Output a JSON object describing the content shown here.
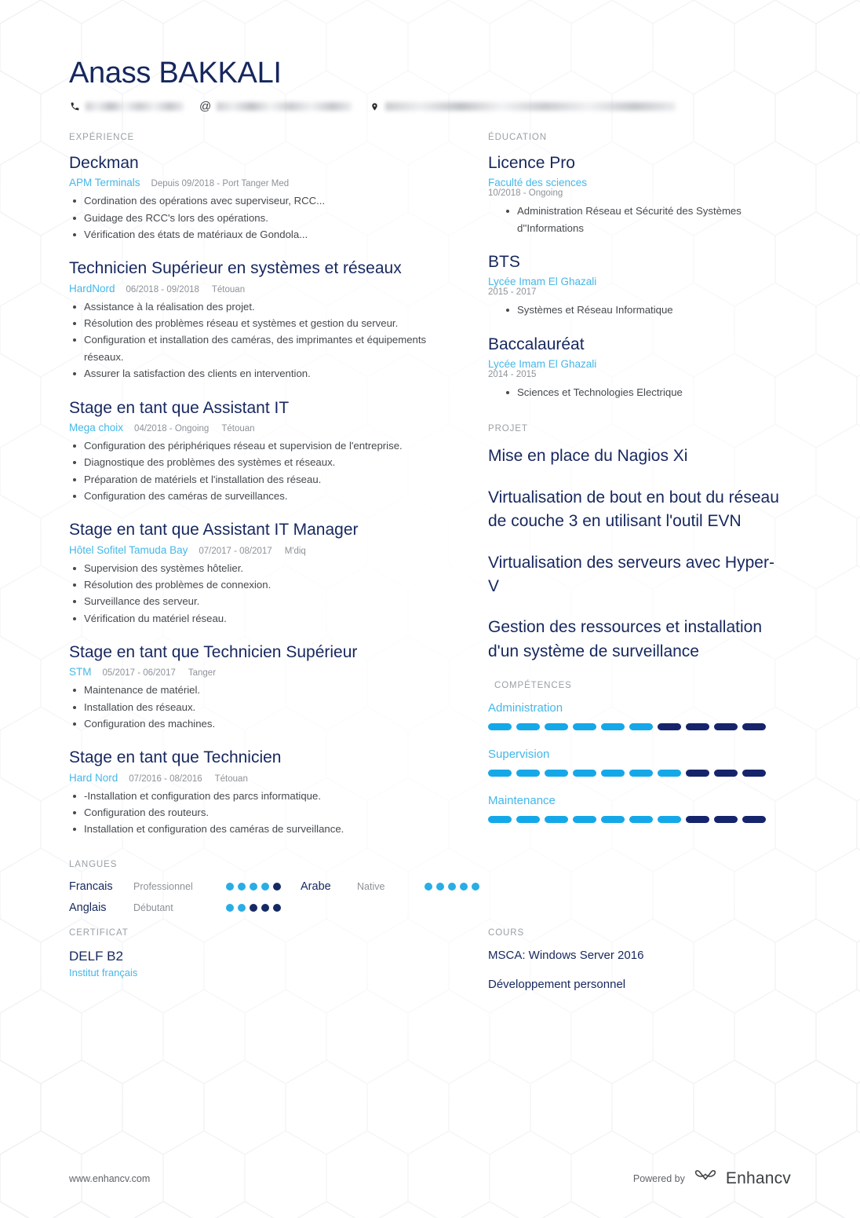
{
  "header": {
    "name": "Anass BAKKALI",
    "contact": {
      "phone_icon": "phone-icon",
      "phone_value": "",
      "email_icon": "at-icon",
      "email_value": "",
      "location_icon": "map-pin-icon",
      "location_value": ""
    }
  },
  "sections": {
    "experience_label": "EXPÉRIENCE",
    "education_label": "ÉDUCATION",
    "project_label": "PROJET",
    "competences_label": "COMPÉTENCES",
    "langues_label": "LANGUES",
    "certificat_label": "CERTIFICAT",
    "cours_label": "COURS"
  },
  "experience": [
    {
      "title": "Deckman",
      "org": "APM Terminals",
      "date": "Depuis 09/2018 - Port Tanger Med",
      "place": "",
      "bullets": [
        "Cordination des opérations avec superviseur, RCC...",
        "Guidage des RCC's lors des opérations.",
        "Vérification des états de matériaux de Gondola..."
      ]
    },
    {
      "title": "Technicien Supérieur en systèmes et réseaux",
      "org": "HardNord",
      "date": "06/2018 - 09/2018",
      "place": "Tétouan",
      "bullets": [
        "Assistance à la réalisation des projet.",
        "Résolution des problèmes réseau et systèmes et gestion du serveur.",
        "Configuration et installation des caméras, des imprimantes et équipements réseaux.",
        "Assurer la satisfaction des clients en intervention."
      ]
    },
    {
      "title": "Stage en tant que Assistant IT",
      "org": "Mega choix",
      "date": "04/2018 - Ongoing",
      "place": "Tétouan",
      "bullets": [
        "Configuration des périphériques réseau et supervision de l'entreprise.",
        "Diagnostique des problèmes des systèmes et réseaux.",
        "Préparation de matériels et l'installation des réseau.",
        "Configuration des caméras de surveillances."
      ]
    },
    {
      "title": "Stage en tant que Assistant IT Manager",
      "org": "Hôtel Sofitel Tamuda Bay",
      "date": "07/2017 - 08/2017",
      "place": "M'diq",
      "bullets": [
        "Supervision des systèmes hôtelier.",
        "Résolution des problèmes de connexion.",
        "Surveillance des serveur.",
        "Vérification du matériel réseau."
      ]
    },
    {
      "title": "Stage en tant que Technicien Supérieur",
      "org": "STM",
      "date": "05/2017 - 06/2017",
      "place": "Tanger",
      "bullets": [
        "Maintenance de matériel.",
        "Installation des réseaux.",
        "Configuration des machines."
      ]
    },
    {
      "title": "Stage en tant que Technicien",
      "org": "Hard Nord",
      "date": "07/2016 - 08/2016",
      "place": "Tétouan",
      "bullets": [
        "-Installation et configuration des parcs informatique.",
        "Configuration des routeurs.",
        "Installation et configuration des caméras de surveillance."
      ]
    }
  ],
  "education": [
    {
      "title": "Licence Pro",
      "org": "Faculté des sciences",
      "date": "10/2018 - Ongoing",
      "bullets": [
        "Administration Réseau et Sécurité des Systèmes d''Informations"
      ]
    },
    {
      "title": "BTS",
      "org": "Lycée Imam El Ghazali",
      "date": "2015 - 2017",
      "bullets": [
        "Systèmes et Réseau Informatique"
      ]
    },
    {
      "title": "Baccalauréat",
      "org": "Lycée Imam El Ghazali",
      "date": "2014 - 2015",
      "bullets": [
        "Sciences et Technologies Electrique"
      ]
    }
  ],
  "projects": [
    "Mise en place du Nagios Xi",
    "Virtualisation de bout en bout du réseau de couche 3 en utilisant l'outil EVN",
    "Virtualisation des serveurs avec Hyper-V",
    "Gestion des ressources et installation d'un système de surveillance"
  ],
  "competences": [
    {
      "name": "Administration",
      "filled": 6,
      "total": 10
    },
    {
      "name": "Supervision",
      "filled": 7,
      "total": 10
    },
    {
      "name": "Maintenance",
      "filled": 7,
      "total": 10
    }
  ],
  "langues": [
    {
      "name": "Francais",
      "level": "Professionnel",
      "filled": 4,
      "total": 5
    },
    {
      "name": "Arabe",
      "level": "Native",
      "filled": 5,
      "total": 5
    },
    {
      "name": "Anglais",
      "level": "Débutant",
      "filled": 2,
      "total": 5
    }
  ],
  "certificat": {
    "title": "DELF B2",
    "org": "Institut français"
  },
  "cours": [
    "MSCA: Windows Server 2016",
    "Développement personnel"
  ],
  "footer": {
    "url": "www.enhancv.com",
    "powered_by": "Powered by",
    "brand": "Enhancv"
  },
  "colors": {
    "navy": "#16275e",
    "accent_light_blue": "#45b7e8",
    "bar_on": "#15a8e8",
    "bar_off": "#16246b",
    "muted": "#8d9298"
  }
}
